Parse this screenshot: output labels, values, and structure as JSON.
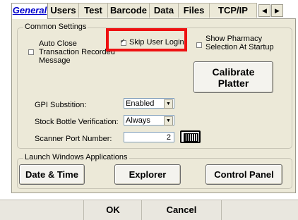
{
  "tabs": [
    {
      "label": "General",
      "active": true
    },
    {
      "label": "Users",
      "active": false
    },
    {
      "label": "Test",
      "active": false
    },
    {
      "label": "Barcode",
      "active": false
    },
    {
      "label": "Data",
      "active": false
    },
    {
      "label": "Files",
      "active": false
    },
    {
      "label": "TCP/IP",
      "active": false
    }
  ],
  "tab_scroll": {
    "left_icon": "scroll-left-icon",
    "right_icon": "scroll-right-icon",
    "left_glyph": "◀",
    "right_glyph": "▶"
  },
  "common_settings": {
    "title": "Common Settings",
    "skip_user_login": {
      "label": "Skip User Login",
      "checked": true
    },
    "show_pharmacy": {
      "label_line1": "Show Pharmacy",
      "label_line2": "Selection At Startup",
      "checked": false
    },
    "auto_close": {
      "label_line1": "Auto Close",
      "label_line2": "Transaction Recorded",
      "label_line3": "Message",
      "checked": false
    },
    "calibrate_button": {
      "label_line1": "Calibrate",
      "label_line2": "Platter"
    },
    "gpi_substition": {
      "label": "GPI Substition:",
      "value": "Enabled"
    },
    "stock_bottle": {
      "label": "Stock Bottle Verification:",
      "value": "Always"
    },
    "scanner_port": {
      "label": "Scanner Port Number:",
      "value": "2"
    }
  },
  "launch_apps": {
    "title": "Launch Windows Applications",
    "date_time": "Date & Time",
    "explorer": "Explorer",
    "control_panel": "Control Panel"
  },
  "footer": {
    "ok": "OK",
    "cancel": "Cancel"
  },
  "colors": {
    "highlight": "#ee1111",
    "active_tab_text": "#0000cc",
    "panel": "#ece9d8"
  }
}
